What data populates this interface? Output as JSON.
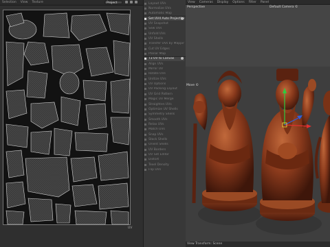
{
  "uv_editor": {
    "menu": [
      "Selection",
      "View",
      "Texture"
    ],
    "mode_select": "Project",
    "corner_label": "UV"
  },
  "uv_tools": {
    "items": [
      {
        "label": "Layout UVs",
        "active": false
      },
      {
        "label": "Normalize UVs",
        "active": false
      },
      {
        "label": "Automatic Map",
        "active": false
      },
      {
        "label": "Set UV4 Auto Projection",
        "active": true,
        "gear": true
      },
      {
        "label": "UV Snapshot",
        "active": false
      },
      {
        "label": "Sew UVs",
        "active": false
      },
      {
        "label": "Unfold UVs",
        "active": false
      },
      {
        "label": "UV Shells",
        "active": false
      },
      {
        "label": "Transfer UVs by Mapping",
        "active": false
      },
      {
        "label": "Cut UV Edges",
        "active": false
      },
      {
        "label": "Planar Map",
        "active": false
      },
      {
        "label": "T3 UV to Canvas",
        "active": true,
        "gear": true
      },
      {
        "label": "Align UVs",
        "active": false
      },
      {
        "label": "Mirror UV",
        "active": false
      },
      {
        "label": "Rotate UVs",
        "active": false
      },
      {
        "label": "Unitize UVs",
        "active": false
      },
      {
        "label": "UV Options",
        "active": false
      },
      {
        "label": "UV Packing Layout",
        "active": false
      },
      {
        "label": "UV Grid Pattern",
        "active": false
      },
      {
        "label": "Magic UV Merge",
        "active": false
      },
      {
        "label": "Straighten UVs",
        "active": false
      },
      {
        "label": "Optimize UV Shells",
        "active": false
      },
      {
        "label": "Symmetry Shells",
        "active": false
      },
      {
        "label": "Smooth UVs",
        "active": false
      },
      {
        "label": "Relax UVs",
        "active": false
      },
      {
        "label": "Match UVs",
        "active": false
      },
      {
        "label": "Snap UVs",
        "active": false
      },
      {
        "label": "Stack Shells",
        "active": false
      },
      {
        "label": "Orient Shells",
        "active": false
      },
      {
        "label": "UV Borders",
        "active": false
      },
      {
        "label": "UV Set Editor",
        "active": false
      },
      {
        "label": "Distort",
        "active": false
      },
      {
        "label": "Texel Density",
        "active": false
      },
      {
        "label": "Flip UVs",
        "active": false
      }
    ]
  },
  "viewport": {
    "menu": [
      "View",
      "Cameras",
      "Display",
      "Options",
      "Filter",
      "Panel"
    ],
    "perspective_label": "Perspective",
    "camera_label": "Default Camera ©",
    "move_label": "Move ©",
    "status_text": "View Transform: Scene"
  },
  "colors": {
    "wood_dark": "#5a2210",
    "wood_mid": "#8a3a1c",
    "wood_light": "#b5602e",
    "gizmo_green": "#2ecc40",
    "gizmo_red": "#e03030",
    "gizmo_blue": "#3060e0"
  }
}
